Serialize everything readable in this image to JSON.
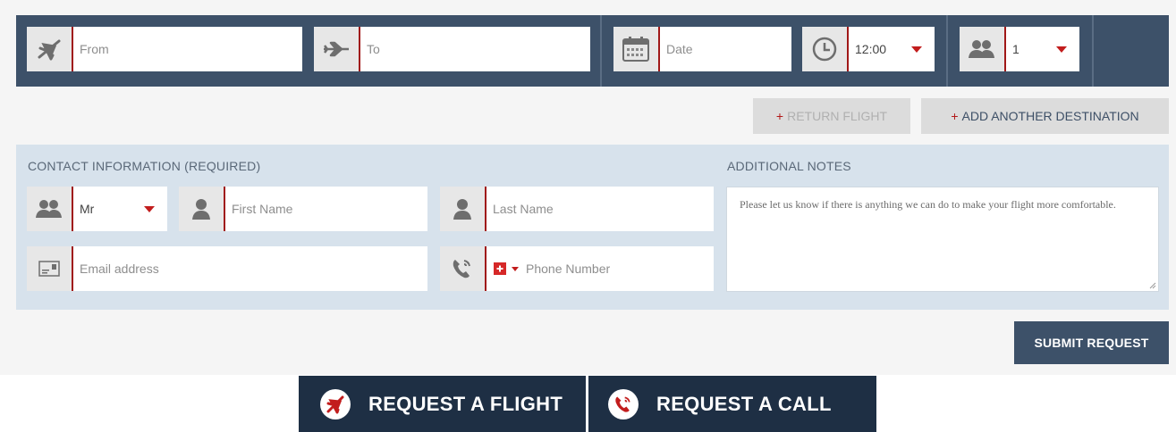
{
  "search": {
    "from_placeholder": "From",
    "to_placeholder": "To",
    "date_placeholder": "Date",
    "time_value": "12:00",
    "passengers_value": "1"
  },
  "actions": {
    "plus": "+",
    "return_flight": "RETURN FLIGHT",
    "add_destination": "ADD ANOTHER DESTINATION"
  },
  "contact": {
    "title": "CONTACT INFORMATION (REQUIRED)",
    "salutation_value": "Mr",
    "first_name_placeholder": "First Name",
    "last_name_placeholder": "Last Name",
    "email_placeholder": "Email address",
    "phone_placeholder": "Phone Number"
  },
  "notes": {
    "title": "ADDITIONAL NOTES",
    "placeholder": "Please let us know if there is anything we can do to make your flight more comfortable."
  },
  "submit_label": "SUBMIT REQUEST",
  "tabs": {
    "request_flight": "REQUEST A FLIGHT",
    "request_call": "REQUEST A CALL"
  },
  "colors": {
    "navy": "#3d5169",
    "dark_navy": "#1e2f44",
    "accent_red": "#c21d1d",
    "panel_blue": "#d7e2ec"
  },
  "icons": {
    "from": "plane-takeoff-icon",
    "to": "plane-landing-icon",
    "date": "calendar-icon",
    "time": "clock-icon",
    "passengers": "users-icon",
    "person": "user-icon",
    "email": "id-card-icon",
    "phone": "phone-icon",
    "flag": "swiss-flag-icon"
  }
}
